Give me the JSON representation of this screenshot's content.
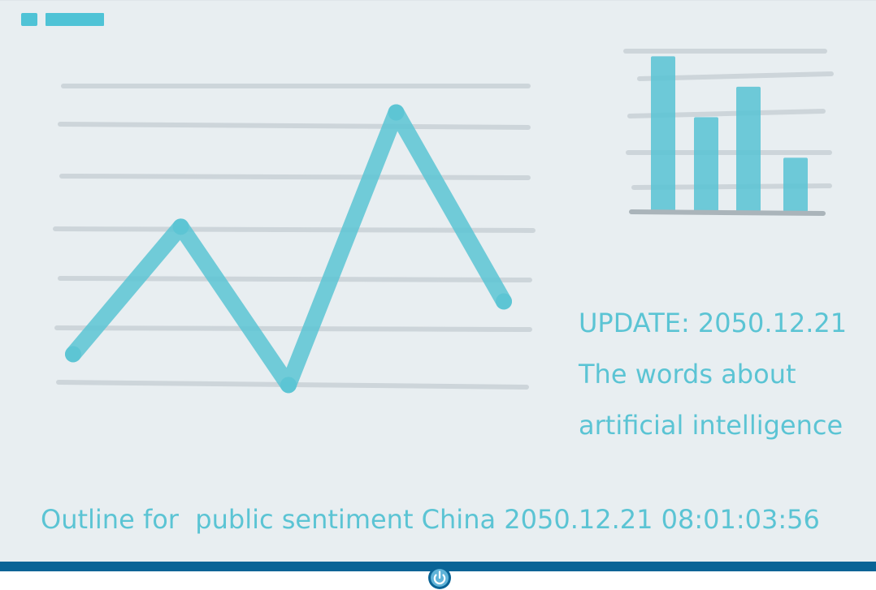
{
  "update_text": "UPDATE: 2050.12.21",
  "words_line1": "The words about",
  "words_line2": "artificial intelligence",
  "outline_text": "Outline for  public sentiment China 2050.12.21 08:01:03:56",
  "colors": {
    "screen_bg": "#e8eef1",
    "accent": "#5bc4d4",
    "grid": "#c9d1d6",
    "bezel": "#0a6496"
  },
  "icons": [
    "logo-icon",
    "power-icon"
  ],
  "chart_data": [
    {
      "type": "line",
      "x": [
        1,
        2,
        3,
        4,
        5
      ],
      "values": [
        0.5,
        3.4,
        -0.2,
        6.0,
        1.7
      ],
      "ylim": [
        -0.6,
        6.6
      ],
      "grid": true,
      "gridlines": 7
    },
    {
      "type": "bar",
      "categories": [
        "1",
        "2",
        "3",
        "4"
      ],
      "values": [
        4.6,
        2.8,
        3.7,
        1.6
      ],
      "ylim": [
        0,
        4.8
      ],
      "grid": true,
      "gridlines": 5
    }
  ]
}
